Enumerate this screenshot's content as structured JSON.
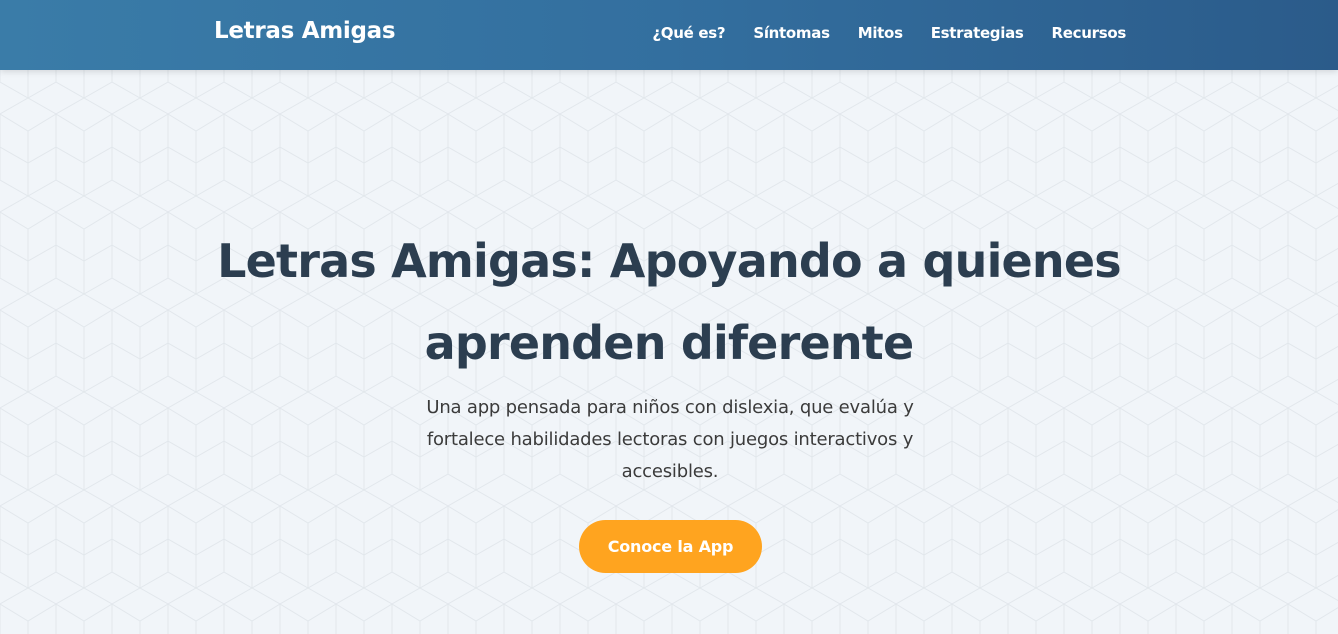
{
  "brand": {
    "name": "Letras Amigas"
  },
  "nav": {
    "items": [
      {
        "label": "¿Qué es?"
      },
      {
        "label": "Síntomas"
      },
      {
        "label": "Mitos"
      },
      {
        "label": "Estrategias"
      },
      {
        "label": "Recursos"
      }
    ]
  },
  "hero": {
    "title": "Letras Amigas: Apoyando a quienes aprenden diferente",
    "subtitle": "Una app pensada para niños con dislexia, que evalúa y fortalece habilidades lectoras con juegos interactivos y accesibles.",
    "cta_label": "Conoce la App"
  },
  "colors": {
    "header_gradient_start": "#3a7ca8",
    "header_gradient_end": "#2b5b8a",
    "background": "#f1f5f9",
    "title_text": "#2c3e50",
    "cta_background": "#ffa41f",
    "cta_text": "#ffffff"
  }
}
